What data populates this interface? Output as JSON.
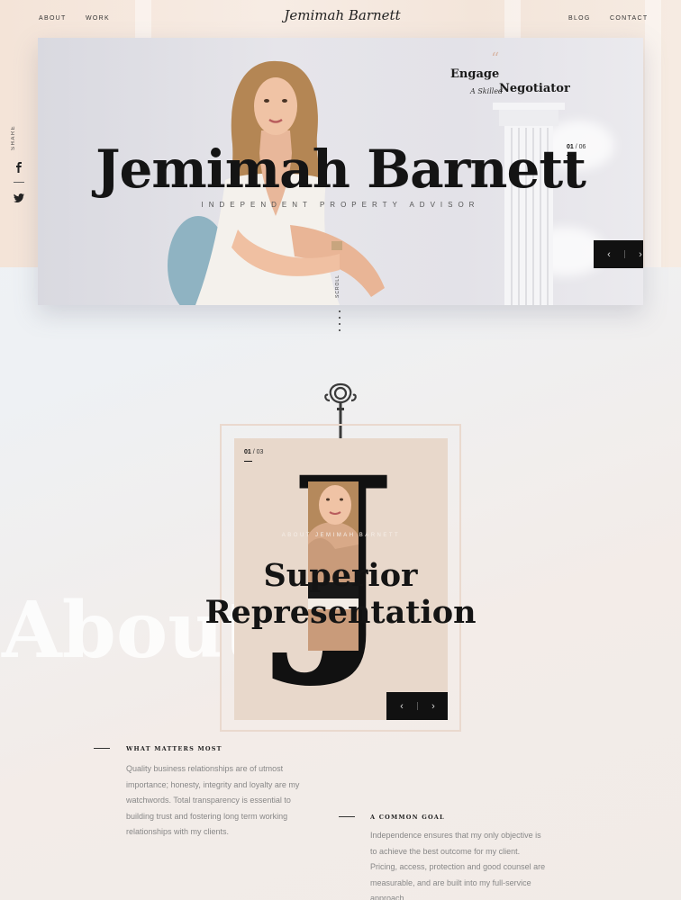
{
  "nav": {
    "left": [
      "About",
      "Work"
    ],
    "right": [
      "Blog",
      "Contact"
    ],
    "logo": "Jemimah Barnett"
  },
  "share": {
    "label": "SHARE",
    "icons": [
      "facebook-icon",
      "twitter-icon"
    ]
  },
  "hero": {
    "name": "Jemimah Barnett",
    "subtitle": "Independent Property Advisor",
    "quote_mark": "“",
    "tagline_1": "Engage",
    "tagline_2": "A Skilled",
    "tagline_3": "Negotiator",
    "counter_current": "01",
    "counter_total": "/ 06",
    "prev_icon": "‹",
    "next_icon": "›",
    "scroll_label": "SCROLL"
  },
  "about": {
    "watermark": "About",
    "card_counter_current": "01",
    "card_counter_total": "/ 03",
    "big_letter": "J",
    "card_label": "About Jemimah Barnett",
    "heading": "Superior Representation",
    "prev_icon": "‹",
    "next_icon": "›"
  },
  "columns": [
    {
      "heading": "What Matters Most",
      "lines": [
        "Quality business relationships are of utmost",
        "importance; honesty, integrity and loyalty are my",
        "watchwords. Total transparency is essential to",
        "building trust and fostering long term working",
        "relationships with my clients."
      ]
    },
    {
      "heading": "A Common Goal",
      "lines": [
        "Independence ensures that my only objective is",
        "to achieve the best outcome for my client.",
        "Pricing, access, protection and good counsel are",
        "measurable, and are built into my full-service",
        "approach."
      ]
    }
  ],
  "colors": {
    "dark": "#111111",
    "card": "#e8d8cb",
    "accent_quote": "#d8b8a8"
  }
}
